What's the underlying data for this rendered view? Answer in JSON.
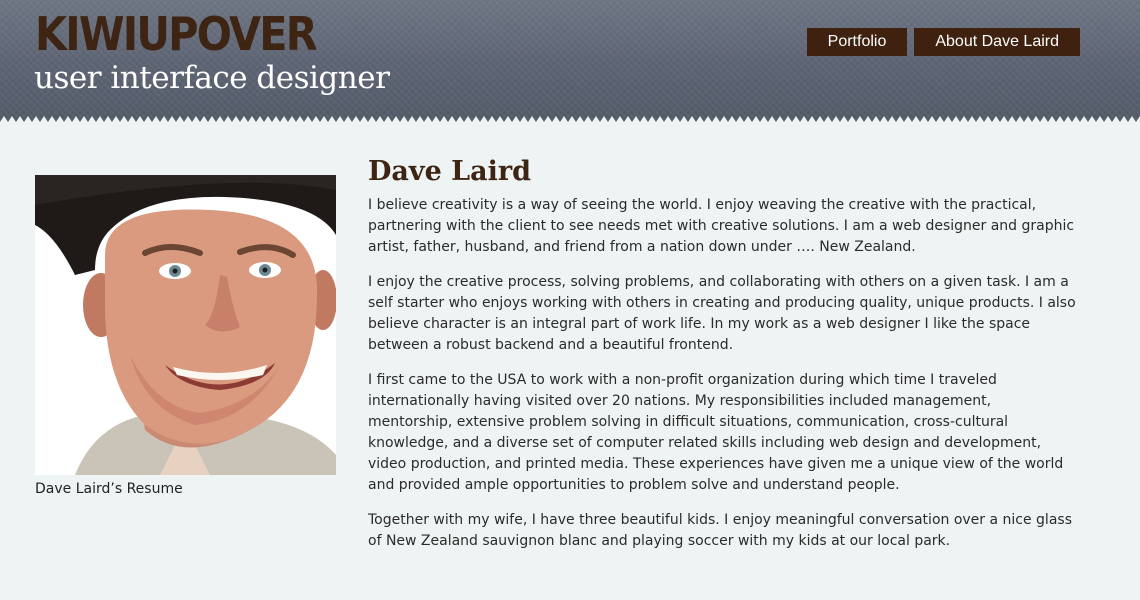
{
  "header": {
    "logo": "KIWIUPOVER",
    "tagline": "user interface designer"
  },
  "nav": {
    "items": [
      {
        "label": "Portfolio"
      },
      {
        "label": "About Dave Laird"
      }
    ]
  },
  "sidebar": {
    "caption": "Dave Laird’s Resume"
  },
  "main": {
    "title": "Dave Laird",
    "paragraphs": [
      "I believe creativity is a way of seeing the world. I enjoy weaving the creative with the practical, partnering with the client to see needs met with creative solutions. I am a web designer and graphic artist, father, husband, and friend from a nation down under …. New Zealand.",
      "I enjoy the creative process, solving problems, and collaborating with others on a given task. I am a self starter who enjoys working with others in creating and producing quality, unique products. I also believe character is an integral part of work life. In my work as a web designer I like the space between a robust backend and a beautiful frontend.",
      "I first came to the USA to work with a non-profit organization during which time I traveled internationally having visited over 20 nations. My responsibilities included management, mentorship, extensive problem solving in difficult situations, communication, cross-cultural knowledge, and a diverse set of computer related skills including web design and development, video production, and printed media. These experiences have given me a unique view of the world and provided ample opportunities to problem solve and understand people.",
      "Together with my wife, I have three beautiful kids. I enjoy meaningful conversation over a nice glass of New Zealand sauvignon blanc and playing soccer with my kids at our local park."
    ]
  },
  "colors": {
    "header_bg": "#5d6473",
    "brand_brown": "#3e2412",
    "nav_bg": "#3e210e",
    "page_bg": "#eef3f4"
  }
}
